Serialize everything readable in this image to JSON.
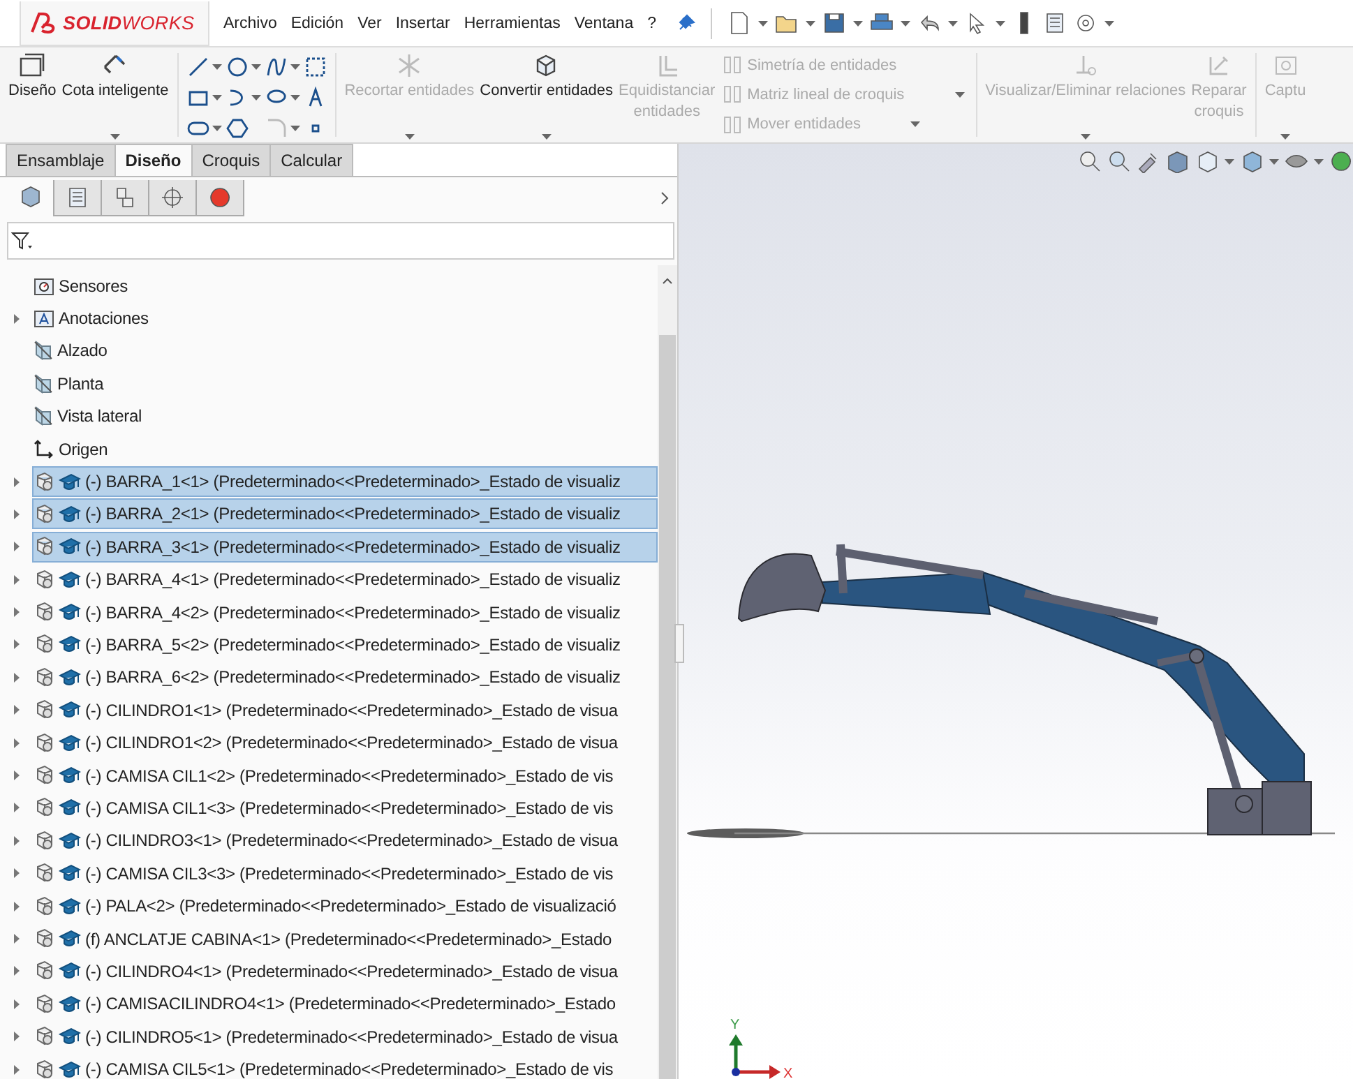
{
  "app": {
    "logo": "**SOLID**WORKS"
  },
  "menu": [
    {
      "label": "Archivo"
    },
    {
      "label": "Edición"
    },
    {
      "label": "Ver"
    },
    {
      "label": "Insertar"
    },
    {
      "label": "Herramientas"
    },
    {
      "label": "Ventana"
    },
    {
      "label": "?"
    }
  ],
  "ribbon": [
    {
      "kind": "large",
      "lines": [
        "Diseño"
      ],
      "disabled": false,
      "dropdown": false
    },
    {
      "kind": "large",
      "lines": [
        "Cota inteligente"
      ],
      "disabled": false,
      "dropdown": true
    },
    {
      "kind": "separator"
    },
    {
      "kind": "grid"
    },
    {
      "kind": "separator"
    },
    {
      "kind": "large",
      "lines": [
        "Recortar entidades"
      ],
      "disabled": true,
      "dropdown": true
    },
    {
      "kind": "large",
      "lines": [
        "Convertir entidades"
      ],
      "disabled": false,
      "dropdown": true
    },
    {
      "kind": "large",
      "lines": [
        "Equidistanciar",
        "entidades"
      ],
      "disabled": true,
      "dropdown": false
    },
    {
      "kind": "stack",
      "entries": [
        {
          "label": "Simetría de entidades",
          "disabled": true,
          "dropdown": false
        },
        {
          "label": "Matriz lineal de croquis",
          "disabled": true,
          "dropdown": true
        },
        {
          "label": "Mover entidades",
          "disabled": true,
          "dropdown": true
        }
      ]
    },
    {
      "kind": "separator"
    },
    {
      "kind": "large",
      "lines": [
        "Visualizar/Eliminar relaciones"
      ],
      "disabled": true,
      "dropdown": true
    },
    {
      "kind": "large",
      "lines": [
        "Reparar",
        "croquis"
      ],
      "disabled": true,
      "dropdown": false
    },
    {
      "kind": "separator"
    },
    {
      "kind": "large",
      "lines": [
        "Captu"
      ],
      "disabled": true,
      "dropdown": true
    }
  ],
  "tabs": [
    {
      "label": "Ensamblaje",
      "selected": false
    },
    {
      "label": "Diseño",
      "selected": true
    },
    {
      "label": "Croquis",
      "selected": false
    },
    {
      "label": "Calcular",
      "selected": false
    }
  ],
  "tree": [
    {
      "kind": "sensors",
      "label": "Sensores",
      "expandable": false,
      "selected": false
    },
    {
      "kind": "annotations",
      "label": "Anotaciones",
      "expandable": true,
      "selected": false
    },
    {
      "kind": "plane",
      "label": "Alzado",
      "expandable": false,
      "selected": false
    },
    {
      "kind": "plane",
      "label": "Planta",
      "expandable": false,
      "selected": false
    },
    {
      "kind": "plane",
      "label": "Vista lateral",
      "expandable": false,
      "selected": false
    },
    {
      "kind": "origin",
      "label": "Origen",
      "expandable": false,
      "selected": false
    },
    {
      "kind": "component",
      "label": "(-) BARRA_1<1> (Predeterminado<<Predeterminado>_Estado de visualiz",
      "expandable": true,
      "selected": true
    },
    {
      "kind": "component",
      "label": "(-) BARRA_2<1> (Predeterminado<<Predeterminado>_Estado de visualiz",
      "expandable": true,
      "selected": true
    },
    {
      "kind": "component",
      "label": "(-) BARRA_3<1> (Predeterminado<<Predeterminado>_Estado de visualiz",
      "expandable": true,
      "selected": true
    },
    {
      "kind": "component",
      "label": "(-) BARRA_4<1> (Predeterminado<<Predeterminado>_Estado de visualiz",
      "expandable": true,
      "selected": false
    },
    {
      "kind": "component",
      "label": "(-) BARRA_4<2> (Predeterminado<<Predeterminado>_Estado de visualiz",
      "expandable": true,
      "selected": false
    },
    {
      "kind": "component",
      "label": "(-) BARRA_5<2> (Predeterminado<<Predeterminado>_Estado de visualiz",
      "expandable": true,
      "selected": false
    },
    {
      "kind": "component",
      "label": "(-) BARRA_6<2> (Predeterminado<<Predeterminado>_Estado de visualiz",
      "expandable": true,
      "selected": false
    },
    {
      "kind": "component",
      "label": "(-) CILINDRO1<1> (Predeterminado<<Predeterminado>_Estado de visua",
      "expandable": true,
      "selected": false
    },
    {
      "kind": "component",
      "label": "(-) CILINDRO1<2> (Predeterminado<<Predeterminado>_Estado de visua",
      "expandable": true,
      "selected": false
    },
    {
      "kind": "component",
      "label": "(-) CAMISA CIL1<2> (Predeterminado<<Predeterminado>_Estado de vis",
      "expandable": true,
      "selected": false
    },
    {
      "kind": "component",
      "label": "(-) CAMISA CIL1<3> (Predeterminado<<Predeterminado>_Estado de vis",
      "expandable": true,
      "selected": false
    },
    {
      "kind": "component",
      "label": "(-) CILINDRO3<1> (Predeterminado<<Predeterminado>_Estado de visua",
      "expandable": true,
      "selected": false
    },
    {
      "kind": "component",
      "label": "(-) CAMISA CIL3<3> (Predeterminado<<Predeterminado>_Estado de vis",
      "expandable": true,
      "selected": false
    },
    {
      "kind": "component",
      "label": "(-) PALA<2> (Predeterminado<<Predeterminado>_Estado de visualizació",
      "expandable": true,
      "selected": false
    },
    {
      "kind": "component",
      "label": "(f) ANCLATJE CABINA<1> (Predeterminado<<Predeterminado>_Estado",
      "expandable": true,
      "selected": false
    },
    {
      "kind": "component",
      "label": "(-) CILINDRO4<1> (Predeterminado<<Predeterminado>_Estado de visua",
      "expandable": true,
      "selected": false
    },
    {
      "kind": "component",
      "label": "(-) CAMISACILINDRO4<1> (Predeterminado<<Predeterminado>_Estado",
      "expandable": true,
      "selected": false
    },
    {
      "kind": "component",
      "label": "(-) CILINDRO5<1> (Predeterminado<<Predeterminado>_Estado de visua",
      "expandable": true,
      "selected": false
    },
    {
      "kind": "component",
      "label": "(-) CAMISA CIL5<1> (Predeterminado<<Predeterminado>_Estado de vis",
      "expandable": true,
      "selected": false
    }
  ],
  "triad": {
    "y_label": "Y",
    "x_label": "X"
  }
}
